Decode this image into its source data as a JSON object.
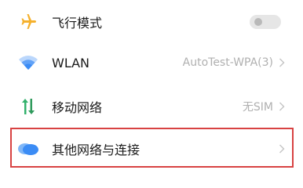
{
  "settings": {
    "items": [
      {
        "label": "飞行模式",
        "icon": "airplane-icon",
        "control": "toggle",
        "toggle_on": false
      },
      {
        "label": "WLAN",
        "icon": "wifi-icon",
        "value": "AutoTest-WPA(3)",
        "control": "chevron"
      },
      {
        "label": "移动网络",
        "icon": "mobile-data-icon",
        "value": "无SIM",
        "control": "chevron"
      },
      {
        "label": "其他网络与连接",
        "icon": "cloud-icon",
        "control": "chevron",
        "highlighted": true
      }
    ]
  },
  "colors": {
    "airplane_icon": "#f5b12d",
    "wifi_icon": "#3b8cf5",
    "mobile_up": "#32b16c",
    "mobile_down": "#2f9a5c",
    "cloud_icon": "#3b8cf5",
    "highlight_border": "#d84242"
  }
}
